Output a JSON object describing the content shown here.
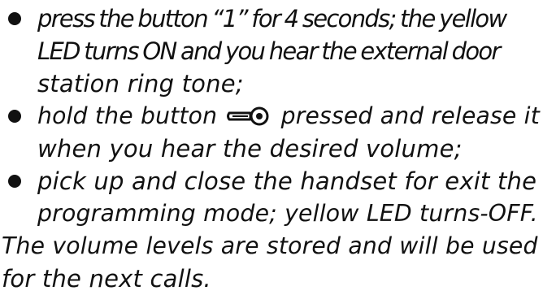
{
  "document": {
    "bullets": [
      {
        "lines": [
          "press the button “1” for 4 seconds; the yellow",
          "LED turns ON and you hear the external door",
          "station ring tone;"
        ]
      },
      {
        "line1_before_icon": "hold the button",
        "line1_after_icon": "pressed and release it",
        "icon": "key-icon",
        "lines_rest": [
          "when you hear the desired volume;"
        ]
      },
      {
        "lines": [
          "pick up and close the handset for exit the",
          "programming mode; yellow LED turns-OFF."
        ]
      }
    ],
    "closing_lines": [
      "The volume levels are stored and will be used",
      "for the next calls."
    ]
  }
}
